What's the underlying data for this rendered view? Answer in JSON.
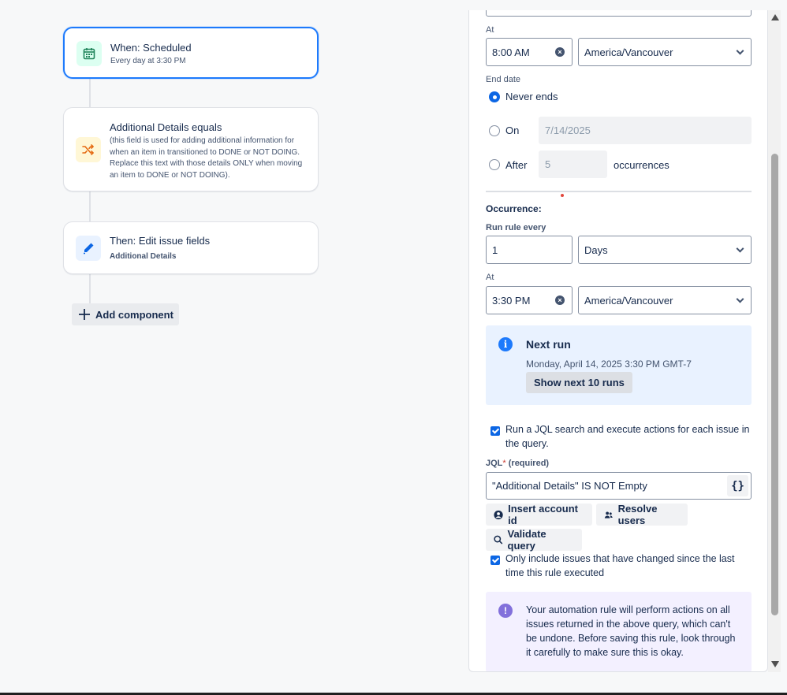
{
  "flow": {
    "trigger": {
      "title": "When: Scheduled",
      "subtitle": "Every day at 3:30 PM"
    },
    "condition": {
      "title": "Additional Details equals",
      "description_lines": [
        "(this field is used for adding additional information for",
        "when an item in transitioned to DONE or NOT DOING.",
        "Replace this text with those details ONLY when moving",
        "an item to DONE or NOT DOING)."
      ]
    },
    "action": {
      "title": "Then: Edit issue fields",
      "subtitle": "Additional Details"
    },
    "add_component_label": "Add component"
  },
  "panel": {
    "start": {
      "at_label": "At",
      "time_value": "8:00 AM",
      "timezone": "America/Vancouver"
    },
    "end_date": {
      "label": "End date",
      "never_label": "Never ends",
      "on_label": "On",
      "on_placeholder": "7/14/2025",
      "after_label": "After",
      "after_placeholder": "5",
      "occurrences_label": "occurrences",
      "selected": "never"
    },
    "occurrence": {
      "heading": "Occurrence:",
      "run_every_label": "Run rule every",
      "interval_value": "1",
      "interval_unit": "Days",
      "at_label": "At",
      "time_value": "3:30 PM",
      "timezone": "America/Vancouver"
    },
    "next_run": {
      "title": "Next run",
      "datetime": "Monday, April 14, 2025 3:30 PM GMT-7",
      "show_button": "Show next 10 runs"
    },
    "jql": {
      "checkbox_lines": [
        "Run a JQL search and execute actions for each issue in",
        "the query."
      ],
      "checkbox_checked": true,
      "label": "JQL",
      "required_marker": "*",
      "required_text": "(required)",
      "value": "\"Additional Details\" IS NOT Empty",
      "braces_label": "{}",
      "insert_account_button": "Insert account id",
      "resolve_users_button": "Resolve users",
      "validate_button": "Validate query",
      "only_changed_lines": [
        "Only include issues that have changed since the last",
        "time this rule executed"
      ],
      "only_changed_checked": true
    },
    "warning": {
      "lines": [
        "Your automation rule will perform actions on all",
        "issues returned in the above query, which can't",
        "be undone. Before saving this rule, look through",
        "it carefully to make sure this is okay."
      ]
    }
  },
  "colors": {
    "primary": "#0c66e4",
    "selected_border": "#1d7afc",
    "trigger_icon_bg": "#dcfff1",
    "trigger_icon": "#1f845a",
    "condition_icon_bg": "#fff7d6",
    "condition_icon": "#e56910",
    "action_icon_bg": "#e9f2ff",
    "action_icon": "#0c66e4",
    "info_bg": "#e9f2ff",
    "warning_bg": "#f3f0ff",
    "warning_icon": "#8270db"
  }
}
